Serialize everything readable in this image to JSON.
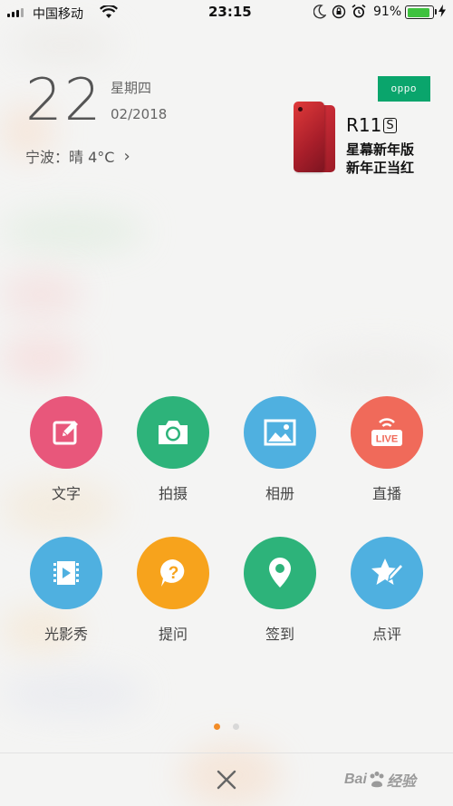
{
  "status_bar": {
    "carrier": "中国移动",
    "time": "23:15",
    "battery_percent": "91%",
    "battery_level": 0.91,
    "icons": [
      "signal-icon",
      "wifi-icon",
      "moon-icon",
      "rotation-lock-icon",
      "alarm-icon",
      "battery-icon"
    ]
  },
  "date": {
    "day": "22",
    "weekday": "星期四",
    "month_year": "02/2018"
  },
  "weather": {
    "text": "宁波：晴 4°C",
    "chevron": "›"
  },
  "ad": {
    "brand": "oppo",
    "model": "R11",
    "model_suffix": "S",
    "line1": "星幕新年版",
    "line2": "新年正当红"
  },
  "grid": [
    {
      "label": "文字",
      "icon": "edit-icon",
      "color": "#e8577b"
    },
    {
      "label": "拍摄",
      "icon": "camera-icon",
      "color": "#2db37a"
    },
    {
      "label": "相册",
      "icon": "image-icon",
      "color": "#4fb0e0"
    },
    {
      "label": "直播",
      "icon": "live-icon",
      "color": "#f06a5a"
    },
    {
      "label": "光影秀",
      "icon": "video-icon",
      "color": "#4fb0e0"
    },
    {
      "label": "提问",
      "icon": "question-icon",
      "color": "#f7a31c"
    },
    {
      "label": "签到",
      "icon": "location-icon",
      "color": "#2db37a"
    },
    {
      "label": "点评",
      "icon": "star-pen-icon",
      "color": "#4fb0e0"
    }
  ],
  "live_badge": "LIVE",
  "pager": {
    "count": 2,
    "active": 0
  },
  "close_icon": "close-icon",
  "watermark": {
    "text_left": "Bai",
    "text_right": "经验"
  }
}
